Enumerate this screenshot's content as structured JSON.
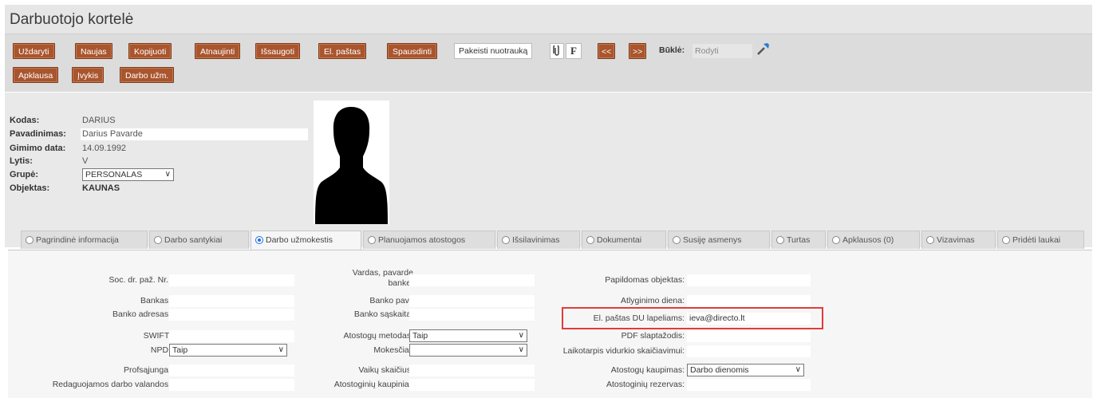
{
  "window": {
    "title": "Darbuotojo kortelė"
  },
  "toolbar": {
    "buttons_row1": [
      "Uždaryti",
      "Naujas",
      "Kopijuoti",
      "Atnaujinti",
      "Išsaugoti",
      "El. paštas",
      "Spausdinti"
    ],
    "change_photo": "Pakeisti nuotrauką",
    "attach_icon": "paperclip-icon",
    "f_label": "F",
    "prev": "<<",
    "next": ">>",
    "status_label": "Būklė:",
    "status_value": "Rodyti",
    "tool_icon": "wrench-icon",
    "buttons_row2": [
      "Apklausa",
      "Įvykis",
      "Darbo užm."
    ]
  },
  "employee": {
    "kodas_label": "Kodas:",
    "kodas": "DARIUS",
    "pavadinimas_label": "Pavadinimas:",
    "pavadinimas": "Darius Pavarde",
    "gimimo_label": "Gimimo data:",
    "gimimo": "14.09.1992",
    "lytis_label": "Lytis:",
    "lytis": "V",
    "grupe_label": "Grupė:",
    "grupe": "PERSONALAS",
    "objektas_label": "Objektas:",
    "objektas": "KAUNAS",
    "photo_icon": "person-silhouette-icon"
  },
  "tabs": [
    {
      "label": "Pagrindinė informacija",
      "active": false
    },
    {
      "label": "Darbo santykiai",
      "active": false
    },
    {
      "label": "Darbo užmokestis",
      "active": true
    },
    {
      "label": "Planuojamos atostogos",
      "active": false
    },
    {
      "label": "Išsilavinimas",
      "active": false
    },
    {
      "label": "Dokumentai",
      "active": false
    },
    {
      "label": "Susiję asmenys",
      "active": false
    },
    {
      "label": "Turtas",
      "active": false
    },
    {
      "label": "Apklausos (0)",
      "active": false
    },
    {
      "label": "Vizavimas",
      "active": false
    },
    {
      "label": "Pridėti laukai",
      "active": false
    }
  ],
  "form": {
    "col1": [
      {
        "label": "Soc. dr. paž. Nr.:",
        "value": ""
      },
      {
        "label": "Bankas:",
        "value": ""
      },
      {
        "label": "Banko adresas:",
        "value": ""
      },
      {
        "label": "SWIFT:",
        "value": ""
      },
      {
        "label": "NPD:",
        "value": "Taip",
        "type": "select"
      },
      {
        "label": "Profsąjunga:",
        "value": ""
      },
      {
        "label": "Redaguojamos darbo valandos:",
        "value": ""
      }
    ],
    "col2": [
      {
        "label1": "Vardas, pavarde",
        "label2": "banke:",
        "value": ""
      },
      {
        "label": "Banko pav.:",
        "value": ""
      },
      {
        "label": "Banko sąskaita:",
        "value": ""
      },
      {
        "label": "Atostogų metodas:",
        "value": "Taip",
        "type": "select"
      },
      {
        "label": "Mokesčiai:",
        "value": "",
        "type": "select"
      },
      {
        "label": "Vaikų skaičius:",
        "value": ""
      },
      {
        "label": "Atostoginių kaupiniai:",
        "value": ""
      }
    ],
    "col3": [
      {
        "label": "Papildomas objektas:",
        "value": ""
      },
      {
        "label": "Atlyginimo diena:",
        "value": ""
      },
      {
        "label": "El. paštas DU lapeliams:",
        "value": "ieva@directo.lt"
      },
      {
        "label": "PDF slaptažodis:",
        "value": ""
      },
      {
        "label": "Laikotarpis vidurkio skaičiavimui:",
        "value": ""
      },
      {
        "label": "Atostogų kaupimas:",
        "value": "Darbo dienomis",
        "type": "select"
      },
      {
        "label": "Atostoginių rezervas:",
        "value": ""
      }
    ]
  }
}
